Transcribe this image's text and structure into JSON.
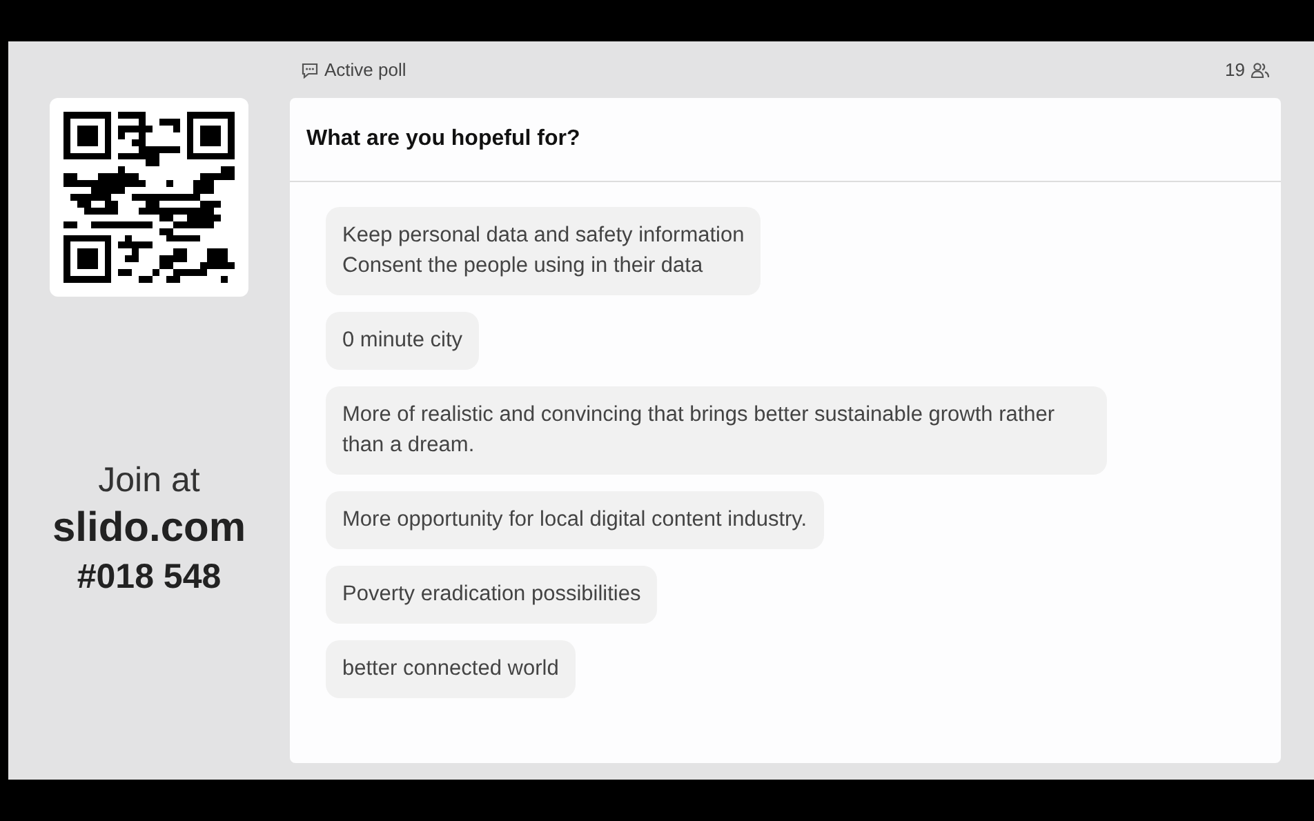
{
  "join": {
    "label": "Join at",
    "site": "slido.com",
    "code": "#018 548"
  },
  "header": {
    "status": "Active poll",
    "participants": "19"
  },
  "poll": {
    "question": "What are you hopeful for?",
    "responses": [
      {
        "text": "Keep personal data and safety information\nConsent the people using in their data"
      },
      {
        "text": "0 minute city"
      },
      {
        "text": "More of realistic and convincing that brings better sustainable growth rather than a dream."
      },
      {
        "text": "More opportunity for local digital content industry."
      },
      {
        "text": "Poverty eradication possibilities"
      },
      {
        "text": "better connected world"
      }
    ]
  }
}
